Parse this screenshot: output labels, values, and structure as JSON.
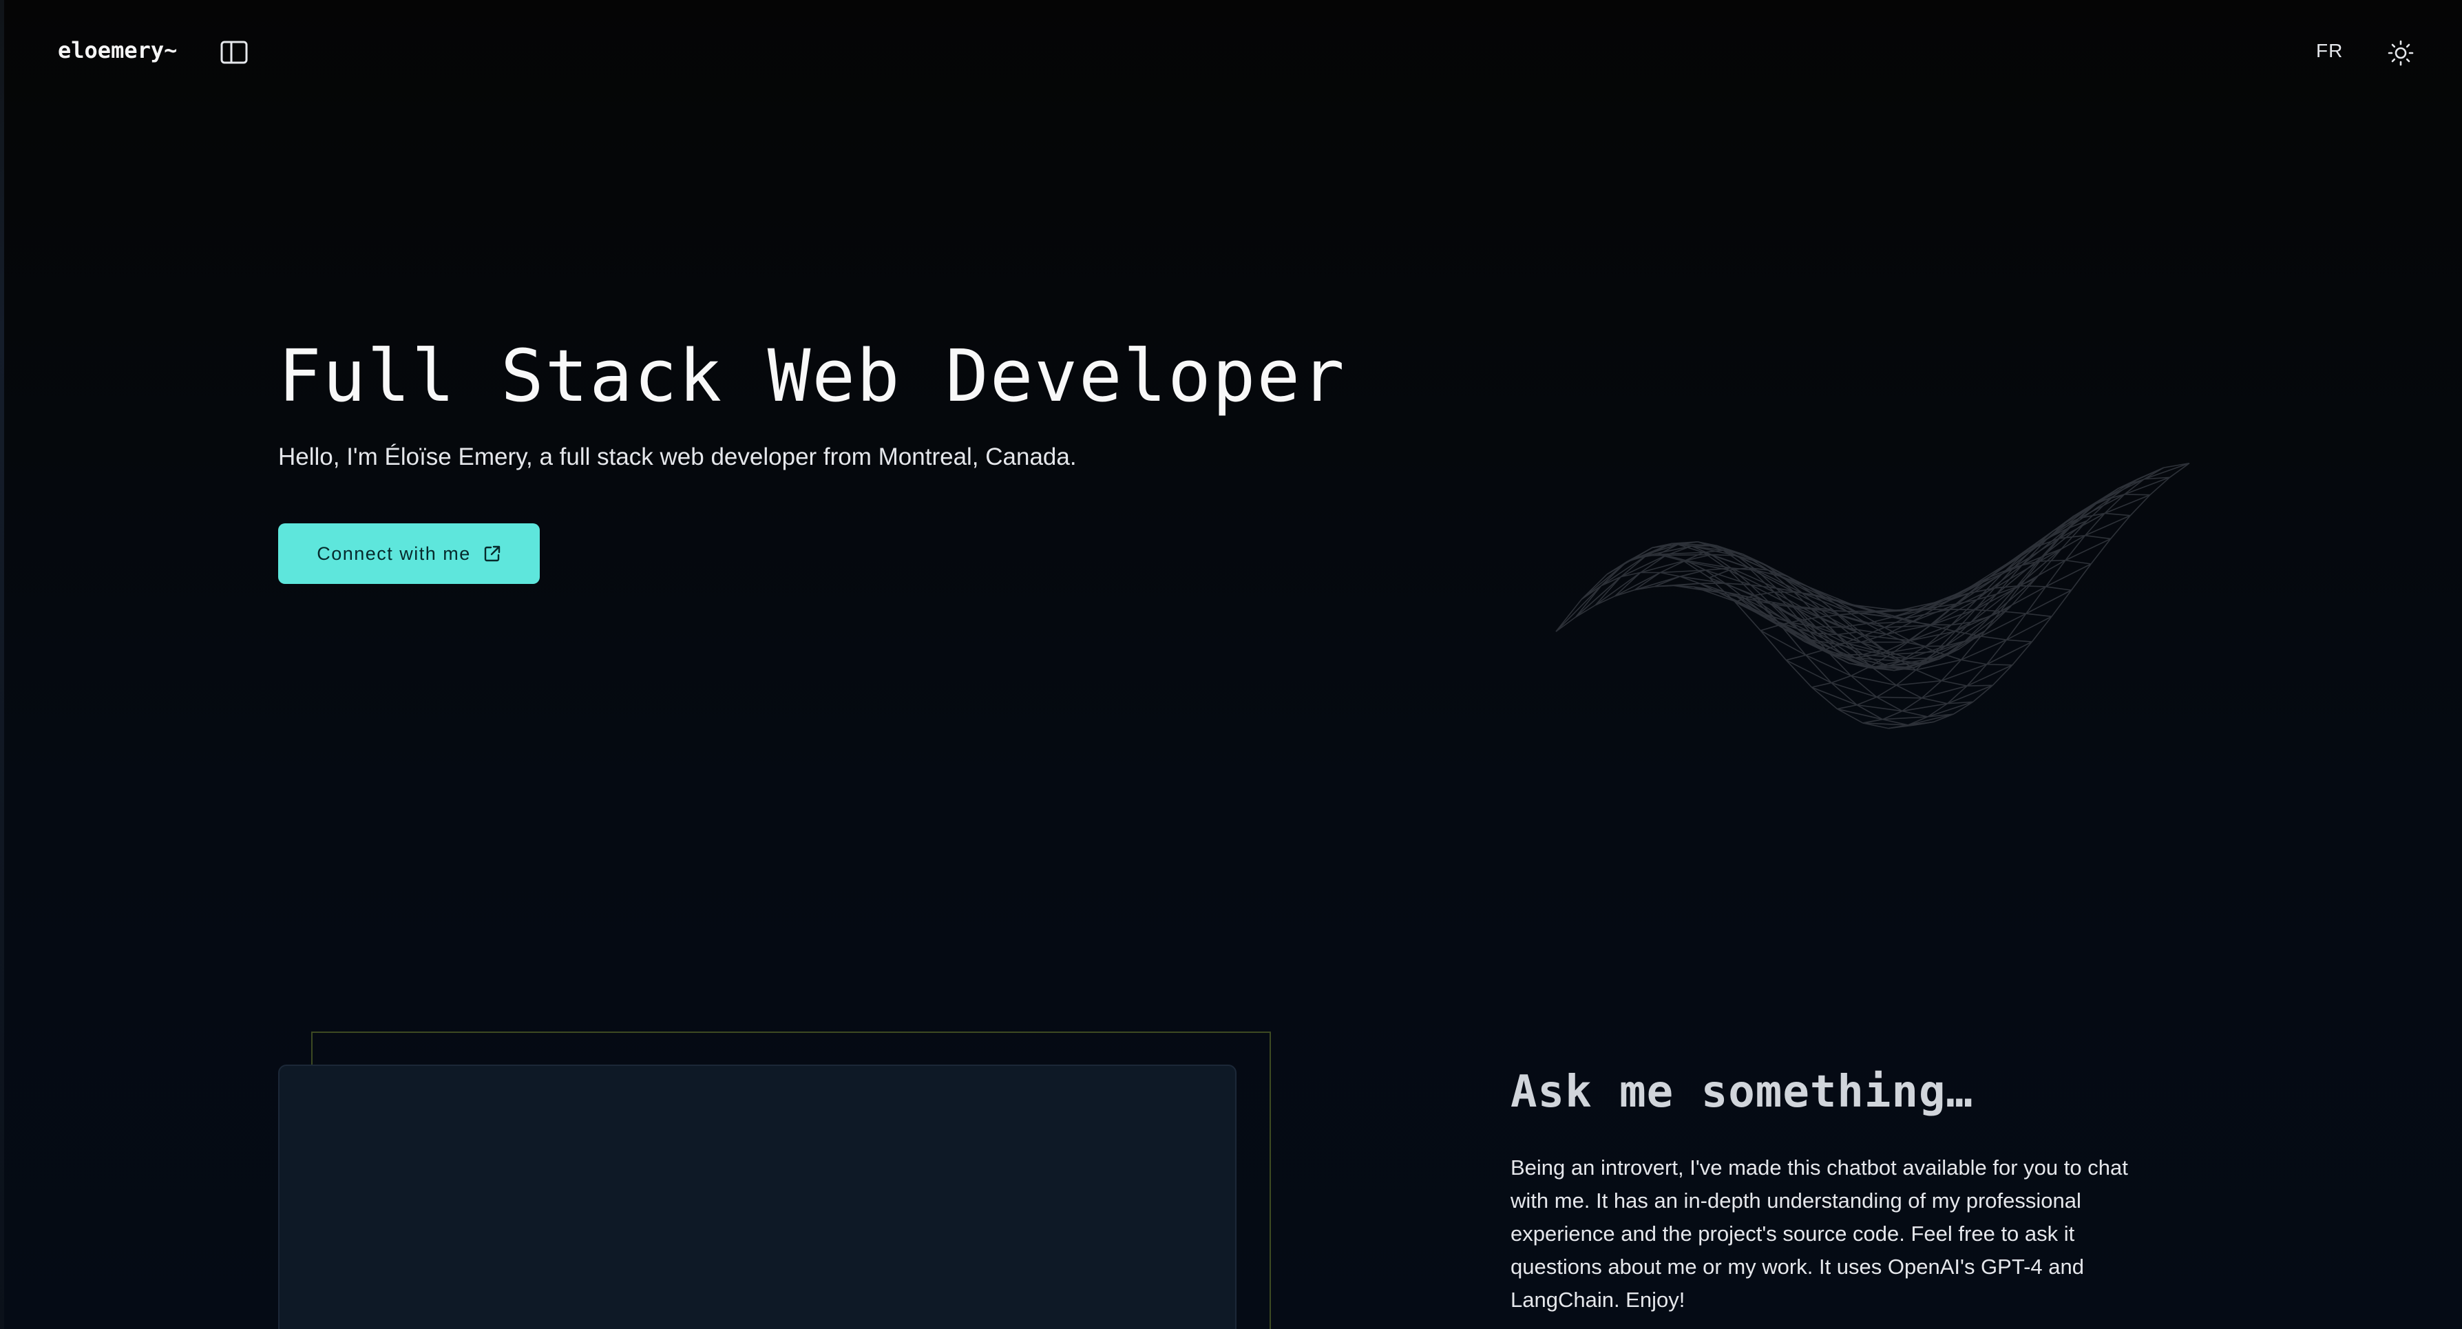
{
  "header": {
    "logo": "eloemery~",
    "sidebar_toggle_icon": "sidebar-panel-icon",
    "language_toggle": "FR",
    "theme_toggle_icon": "sun-icon"
  },
  "hero": {
    "title": "Full Stack Web Developer",
    "subtitle": "Hello, I'm Éloïse Emery, a full stack web developer from Montreal, Canada.",
    "cta_label": "Connect with me",
    "cta_icon": "external-link-icon"
  },
  "chatbot": {
    "heading": "Ask me something…",
    "description": "Being an introvert, I've made this chatbot available for you to chat with me. It has an in-depth understanding of my professional experience and the project's source code. Feel free to ask it questions about me or my work. It uses OpenAI's GPT-4 and LangChain. Enjoy!"
  },
  "colors": {
    "background": "#050a12",
    "accent": "#5ee6dc",
    "panel": "#0e1926",
    "frame_border": "#3d4a22"
  }
}
